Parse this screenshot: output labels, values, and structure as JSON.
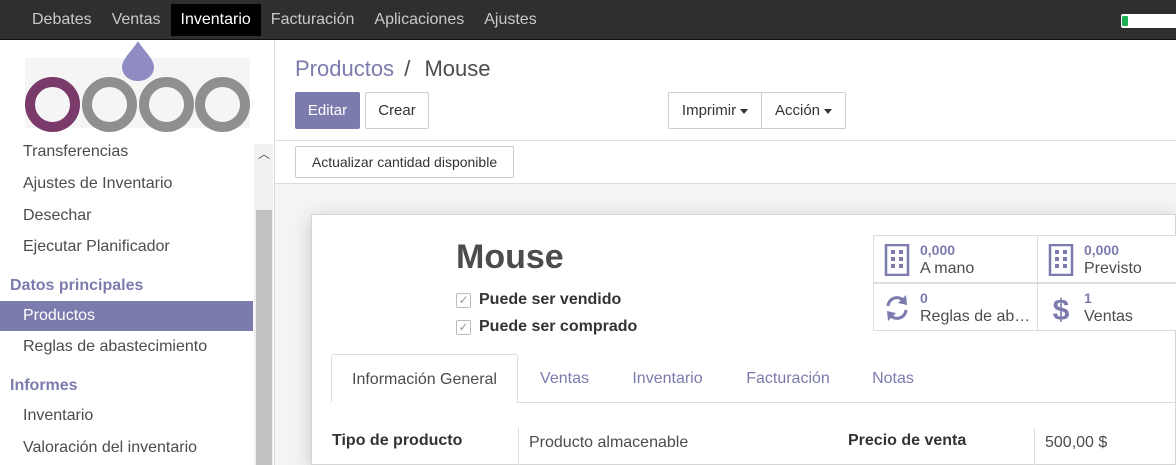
{
  "topbar": {
    "menu": [
      "Debates",
      "Ventas",
      "Inventario",
      "Facturación",
      "Aplicaciones",
      "Ajustes"
    ],
    "active_index": 2,
    "battery_level": 0.1
  },
  "sidebar": {
    "items_top": [
      "Transferencias",
      "Ajustes de Inventario",
      "Desechar",
      "Ejecutar Planificador"
    ],
    "section_master": "Datos principales",
    "items_master": [
      "Productos",
      "Reglas de abastecimiento"
    ],
    "section_reports": "Informes",
    "items_reports": [
      "Inventario",
      "Valoración del inventario"
    ]
  },
  "breadcrumb": {
    "parent": "Productos",
    "separator": "/",
    "current": "Mouse"
  },
  "buttons": {
    "edit": "Editar",
    "create": "Crear",
    "print": "Imprimir",
    "action": "Acción",
    "update_qty": "Actualizar cantidad disponible"
  },
  "product": {
    "name": "Mouse",
    "can_be_sold": "Puede ser vendido",
    "can_be_purchased": "Puede ser comprado",
    "check_mark": "✓"
  },
  "smart_buttons": [
    {
      "value": "0,000",
      "label": "A mano",
      "icon": "building-icon"
    },
    {
      "value": "0,000",
      "label": "Previsto",
      "icon": "building-icon"
    },
    {
      "value": "0",
      "label": "Reglas de abastecimiento",
      "icon": "refresh-icon"
    },
    {
      "value": "1",
      "label": "Ventas",
      "icon": "dollar-icon"
    }
  ],
  "tabs": [
    "Información General",
    "Ventas",
    "Inventario",
    "Facturación",
    "Notas"
  ],
  "fields": {
    "product_type_label": "Tipo de producto",
    "product_type_value": "Producto almacenable",
    "sale_price_label": "Precio de venta",
    "sale_price_value": "500,00 $"
  },
  "colors": {
    "accent": "#7c7bad",
    "topbar": "#2f2f2f"
  }
}
